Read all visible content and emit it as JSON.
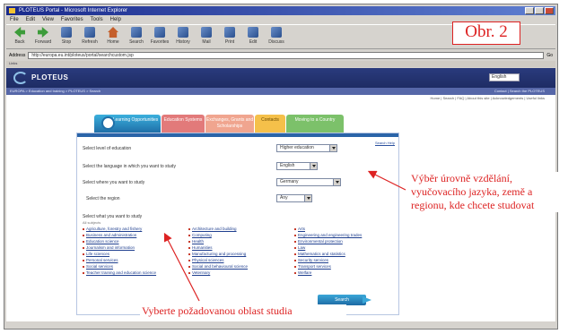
{
  "figure_label": "Obr. 2",
  "browser": {
    "title": "PLOTEUS Portal - Microsoft Internet Explorer",
    "menu": [
      "File",
      "Edit",
      "View",
      "Favorites",
      "Tools",
      "Help"
    ],
    "toolbar": [
      "Back",
      "Forward",
      "Stop",
      "Refresh",
      "Home",
      "Search",
      "Favorites",
      "History",
      "Mail",
      "Print",
      "Edit",
      "Discuss"
    ],
    "address_label": "Address",
    "address_value": "http://europa.eu.int/ploteus/portal/searchcustom.jsp",
    "go_label": "Go",
    "links_label": "Links"
  },
  "site": {
    "logo": "PLOTEUS",
    "language": "English",
    "nav_left": "EUROPA > Education and training > PLOTEUS > Search",
    "nav_right": "Contact | Search the PLOTEUS",
    "subnav": "Home | Search | FAQ | About this site | Acknowledgements | Useful links"
  },
  "tabs": [
    {
      "label": "Learning Opportunities"
    },
    {
      "label": "Education Systems"
    },
    {
      "label": "Exchanges, Grants and Scholarships"
    },
    {
      "label": "Contacts"
    },
    {
      "label": "Moving to a Country"
    }
  ],
  "form": {
    "help_link": "Search Help",
    "rows": [
      {
        "label": "Select level of education",
        "value": "Higher education"
      },
      {
        "label": "Select the language in which you want to study",
        "value": "English"
      },
      {
        "label": "Select where you want to study",
        "value": "Germany"
      },
      {
        "label": "Select the region",
        "value": "Any"
      }
    ],
    "choose_title": "Select what you want to study",
    "choose_sub": "All subjects",
    "areas": [
      "Agriculture, forestry and fishery",
      "Architecture and building",
      "Arts",
      "Business and administration",
      "Computing",
      "Engineering and engineering trades",
      "Education science",
      "Health",
      "Environmental protection",
      "Journalism and information",
      "Humanities",
      "Law",
      "Life sciences",
      "Manufacturing and processing",
      "Mathematics and statistics",
      "Personal services",
      "Physical sciences",
      "Security services",
      "Social services",
      "Social and behavioural science",
      "Transport services",
      "Teacher training and education science",
      "Veterinary",
      "Welfare"
    ],
    "search_button": "Search"
  },
  "annotations": {
    "right": "Výběr úrovně vzdělání, vyučovacího jazyka, země a regionu, kde chcete studovat",
    "bottom": "Vyberte požadovanou oblast studia"
  }
}
